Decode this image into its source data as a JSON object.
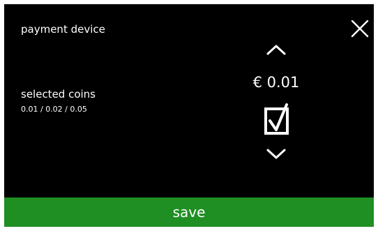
{
  "header": {
    "title": "payment device"
  },
  "icons": {
    "close": "close-icon",
    "up": "chevron-up-icon",
    "down": "chevron-down-icon",
    "checkbox": "checkbox-checked-icon"
  },
  "setting": {
    "label": "selected coins",
    "selected_values": "0.01 / 0.02 / 0.05",
    "current_coin": "€ 0.01",
    "checked": true
  },
  "footer": {
    "save_label": "save"
  },
  "colors": {
    "background": "#000000",
    "text": "#ffffff",
    "save_bar": "#1f8e23"
  }
}
